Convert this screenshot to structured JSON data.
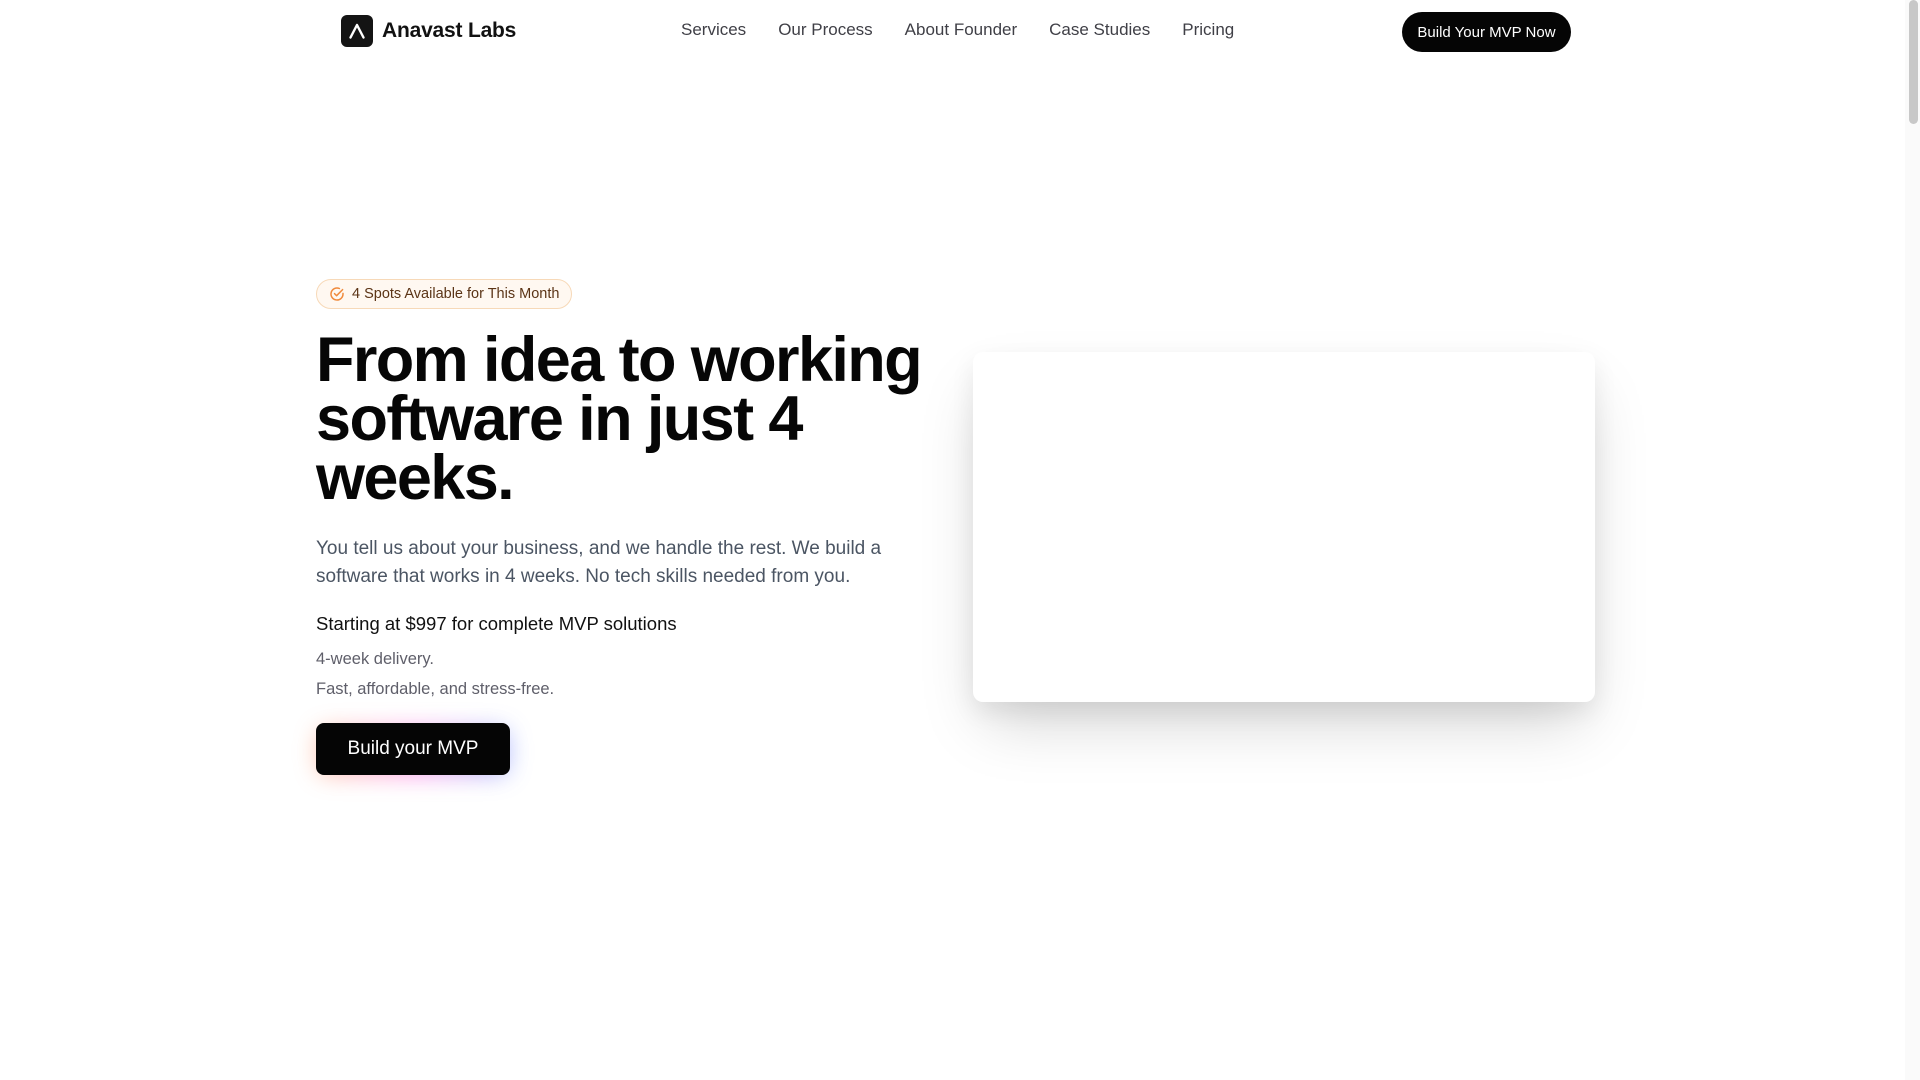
{
  "nav": {
    "brand_name": "Anavast Labs",
    "brand_icon": "anavast-logo-icon",
    "links": [
      {
        "label": "Services"
      },
      {
        "label": "Our Process"
      },
      {
        "label": "About Founder"
      },
      {
        "label": "Case Studies"
      },
      {
        "label": "Pricing"
      }
    ],
    "cta_label": "Build Your MVP Now"
  },
  "hero": {
    "badge_icon": "check-circle-icon",
    "badge_text": "4 Spots Available for This Month",
    "title_lines": [
      "From idea to working",
      "software in just 4",
      "weeks."
    ],
    "description_lines": [
      "You tell us about your business, and we handle the rest. We build a",
      "software that works in 4 weeks. No tech skills needed from you."
    ],
    "price_text": "Starting at $997 for complete MVP solutions",
    "features": [
      "4-week delivery.",
      "Fast, affordable, and stress-free."
    ],
    "cta_label": "Build your MVP"
  },
  "colors": {
    "primary": "#050505",
    "badge_background": "#fff8f1",
    "badge_border": "#f7d9b8",
    "badge_accent": "#f08a3c",
    "body_text": "#4b5563"
  }
}
